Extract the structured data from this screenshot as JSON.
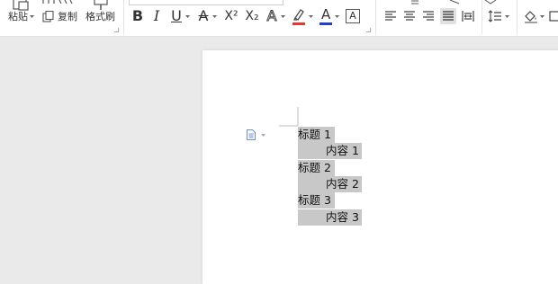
{
  "toolbar": {
    "paste_label": "粘贴",
    "copy_label": "复制",
    "format_painter_label": "格式刷",
    "bold_label": "B",
    "italic_label": "I",
    "underline_label": "U",
    "strike_label": "A",
    "superscript_label": "X²",
    "subscript_label": "X₂",
    "text_effect_label": "A",
    "highlight_label": "A",
    "font_color_label": "A",
    "char_border_label": "A"
  },
  "colors": {
    "highlight": "#e53935",
    "font_color": "#1e3fcf",
    "selection": "#c8c8c8",
    "page": "#ffffff",
    "canvas": "#eaeaea"
  },
  "document": {
    "lines": [
      {
        "text": "标题 1",
        "level": 1
      },
      {
        "text": "内容 1",
        "level": 2
      },
      {
        "text": "标题 2",
        "level": 1
      },
      {
        "text": "内容 2",
        "level": 2
      },
      {
        "text": "标题 3",
        "level": 1
      },
      {
        "text": "内容 3",
        "level": 2
      }
    ]
  },
  "icons": {
    "paste": "clipboard-icon",
    "copy": "copy-icon",
    "format_painter": "paintbrush-icon",
    "paragraph_marker": "document-icon"
  }
}
